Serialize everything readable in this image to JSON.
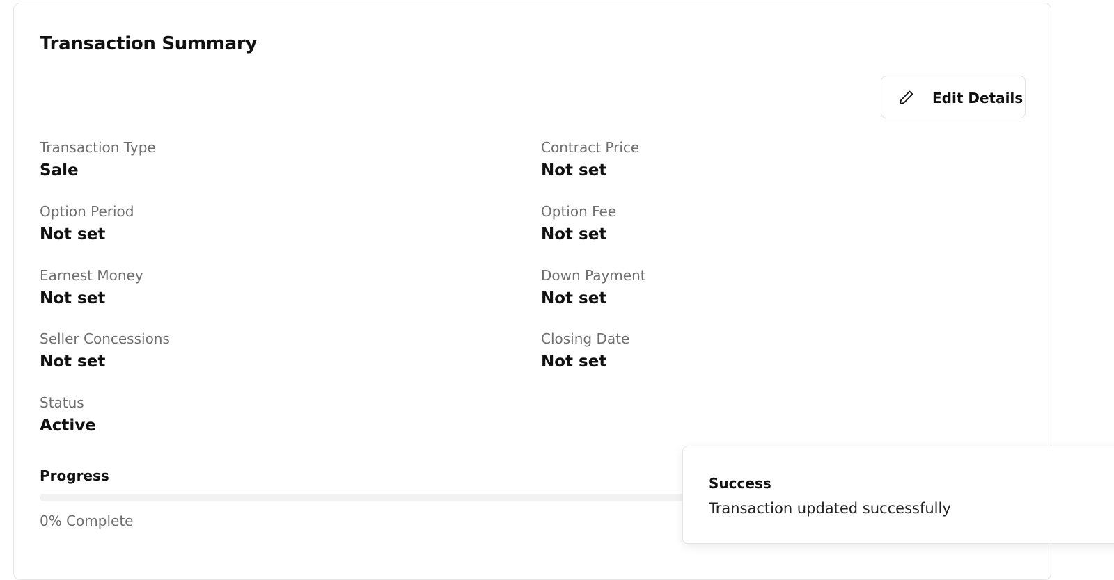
{
  "card": {
    "title": "Transaction Summary",
    "edit_button_label": "Edit Details",
    "edit_button_icon": "pencil-icon"
  },
  "fields": {
    "transaction_type": {
      "label": "Transaction Type",
      "value": "Sale"
    },
    "contract_price": {
      "label": "Contract Price",
      "value": "Not set"
    },
    "option_period": {
      "label": "Option Period",
      "value": "Not set"
    },
    "option_fee": {
      "label": "Option Fee",
      "value": "Not set"
    },
    "earnest_money": {
      "label": "Earnest Money",
      "value": "Not set"
    },
    "down_payment": {
      "label": "Down Payment",
      "value": "Not set"
    },
    "seller_concessions": {
      "label": "Seller Concessions",
      "value": "Not set"
    },
    "closing_date": {
      "label": "Closing Date",
      "value": "Not set"
    },
    "status": {
      "label": "Status",
      "value": "Active"
    }
  },
  "progress": {
    "title": "Progress",
    "percent": 0,
    "text": "0% Complete"
  },
  "toast": {
    "title": "Success",
    "message": "Transaction updated successfully"
  },
  "colors": {
    "label_gray": "#6f6f6f",
    "text_dark": "#111111",
    "border": "#e6e6e6",
    "track": "#f2f2f2"
  }
}
